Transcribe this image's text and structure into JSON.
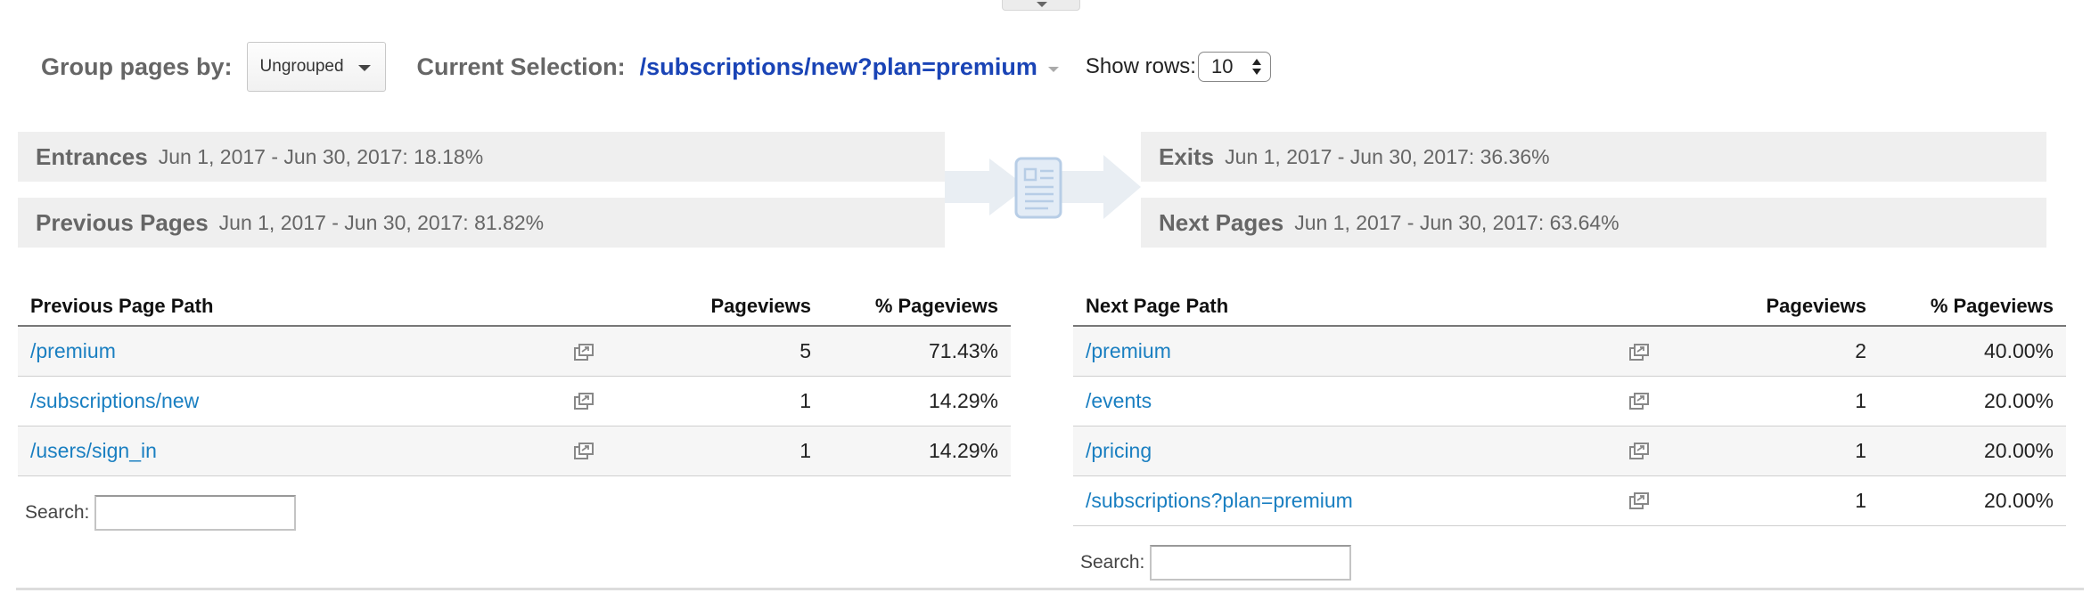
{
  "controls": {
    "group_label": "Group pages by:",
    "group_value": "Ungrouped",
    "selection_label": "Current Selection:",
    "selection_value": "/subscriptions/new?plan=premium",
    "rows_label": "Show rows:",
    "rows_value": "10"
  },
  "summary": {
    "entrances": {
      "title": "Entrances",
      "value": "Jun 1, 2017 - Jun 30, 2017: 18.18%"
    },
    "previous_pages": {
      "title": "Previous Pages",
      "value": "Jun 1, 2017 - Jun 30, 2017: 81.82%"
    },
    "exits": {
      "title": "Exits",
      "value": "Jun 1, 2017 - Jun 30, 2017: 36.36%"
    },
    "next_pages": {
      "title": "Next Pages",
      "value": "Jun 1, 2017 - Jun 30, 2017: 63.64%"
    }
  },
  "previous_table": {
    "headers": {
      "path": "Previous Page Path",
      "pageviews": "Pageviews",
      "pct": "% Pageviews"
    },
    "rows": [
      {
        "path": "/premium",
        "pageviews": "5",
        "pct": "71.43%"
      },
      {
        "path": "/subscriptions/new",
        "pageviews": "1",
        "pct": "14.29%"
      },
      {
        "path": "/users/sign_in",
        "pageviews": "1",
        "pct": "14.29%"
      }
    ],
    "search_label": "Search:"
  },
  "next_table": {
    "headers": {
      "path": "Next Page Path",
      "pageviews": "Pageviews",
      "pct": "% Pageviews"
    },
    "rows": [
      {
        "path": "/premium",
        "pageviews": "2",
        "pct": "40.00%"
      },
      {
        "path": "/events",
        "pageviews": "1",
        "pct": "20.00%"
      },
      {
        "path": "/pricing",
        "pageviews": "1",
        "pct": "20.00%"
      },
      {
        "path": "/subscriptions?plan=premium",
        "pageviews": "1",
        "pct": "20.00%"
      }
    ],
    "search_label": "Search:"
  },
  "icons": {
    "popout": "open-in-new-window-icon",
    "flow": "page-flow-icon",
    "group_dropdown": "chevron-down-icon"
  },
  "colors": {
    "link": "#1a7fc1",
    "selection": "#1a44b6",
    "bar_bg": "#efefef"
  }
}
